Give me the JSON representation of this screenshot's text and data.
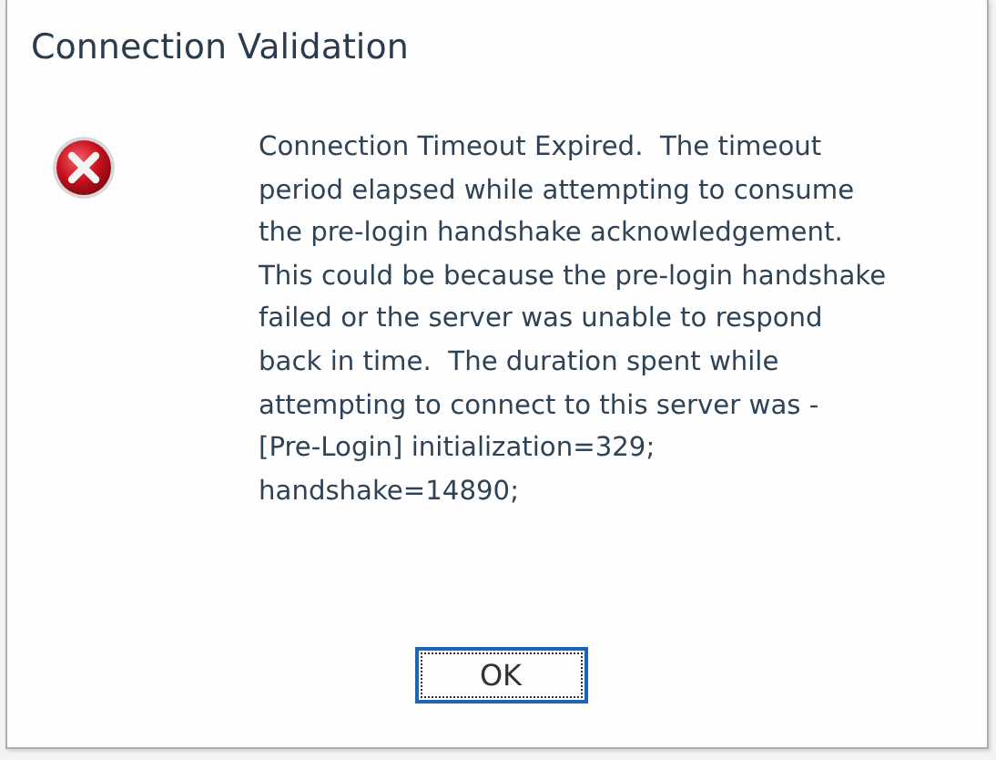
{
  "dialog": {
    "title": "Connection Validation",
    "message": "Connection Timeout Expired.  The timeout period elapsed while attempting to consume the pre-login handshake acknowledgement.  This could be because the pre-login handshake failed or the server was unable to respond back in time.  The duration spent while attempting to connect to this server was - [Pre-Login] initialization=329; handshake=14890;",
    "buttons": [
      {
        "label": "OK",
        "focused": true
      }
    ]
  }
}
